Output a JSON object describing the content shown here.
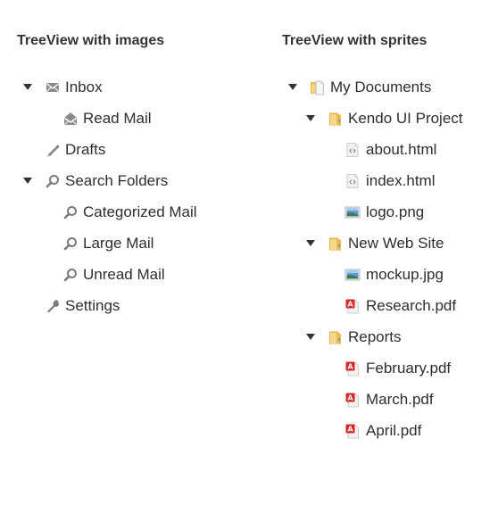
{
  "left": {
    "heading": "TreeView with images",
    "items": [
      {
        "label": "Inbox",
        "icon": "mail-icon",
        "expanded": true,
        "level": 1
      },
      {
        "label": "Read Mail",
        "icon": "mail-open-icon",
        "level": 2
      },
      {
        "label": "Drafts",
        "icon": "pencil-icon",
        "level": 1
      },
      {
        "label": "Search Folders",
        "icon": "search-icon",
        "expanded": true,
        "level": 1
      },
      {
        "label": "Categorized Mail",
        "icon": "search-icon",
        "level": 2
      },
      {
        "label": "Large Mail",
        "icon": "search-icon",
        "level": 2
      },
      {
        "label": "Unread Mail",
        "icon": "search-icon",
        "level": 2
      },
      {
        "label": "Settings",
        "icon": "wrench-icon",
        "level": 1
      }
    ]
  },
  "right": {
    "heading": "TreeView with sprites",
    "items": [
      {
        "label": "My Documents",
        "icon": "folder-documents-icon",
        "expanded": true,
        "level": 1
      },
      {
        "label": "Kendo UI Project",
        "icon": "folder-icon",
        "expanded": true,
        "level": 2
      },
      {
        "label": "about.html",
        "icon": "html-file-icon",
        "level": 3
      },
      {
        "label": "index.html",
        "icon": "html-file-icon",
        "level": 3
      },
      {
        "label": "logo.png",
        "icon": "image-file-icon",
        "level": 3
      },
      {
        "label": "New Web Site",
        "icon": "folder-icon",
        "expanded": true,
        "level": 2
      },
      {
        "label": "mockup.jpg",
        "icon": "image-file-icon",
        "level": 3
      },
      {
        "label": "Research.pdf",
        "icon": "pdf-file-icon",
        "level": 3
      },
      {
        "label": "Reports",
        "icon": "folder-icon",
        "expanded": true,
        "level": 2
      },
      {
        "label": "February.pdf",
        "icon": "pdf-file-icon",
        "level": 3
      },
      {
        "label": "March.pdf",
        "icon": "pdf-file-icon",
        "level": 3
      },
      {
        "label": "April.pdf",
        "icon": "pdf-file-icon",
        "level": 3
      }
    ]
  },
  "colors": {
    "text": "#2e2e2e",
    "heading": "#333333",
    "folder": "#f0c560",
    "pdf": "#d62828"
  }
}
